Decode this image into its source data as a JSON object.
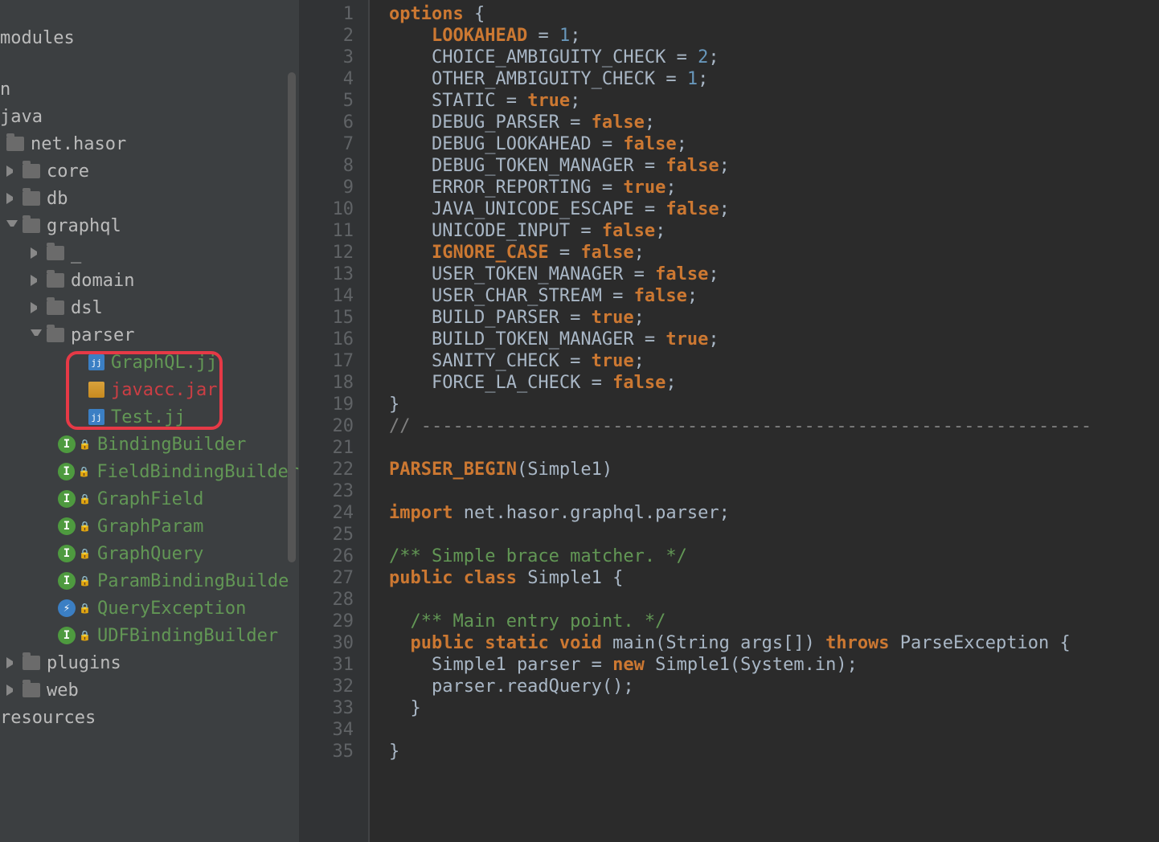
{
  "tree": {
    "modules": "modules",
    "n": "n",
    "java": "java",
    "net_hasor": "net.hasor",
    "core": "core",
    "db": "db",
    "graphql": "graphql",
    "underscore": "_",
    "domain": "domain",
    "dsl": "dsl",
    "parser": "parser",
    "graphql_jj": "GraphQL.jj",
    "javacc_jar": "javacc.jar",
    "test_jj": "Test.jj",
    "binding_builder": "BindingBuilder",
    "field_binding_builder": "FieldBindingBuilder",
    "graph_field": "GraphField",
    "graph_param": "GraphParam",
    "graph_query": "GraphQuery",
    "param_binding_builder": "ParamBindingBuilde",
    "query_exception": "QueryException",
    "udf_binding_builder": "UDFBindingBuilder",
    "plugins": "plugins",
    "web": "web",
    "resources": "resources"
  },
  "code": {
    "lines": [
      {
        "n": 1,
        "t": [
          {
            "c": "k-orange",
            "s": "options"
          },
          {
            "c": "plain",
            "s": " {"
          }
        ]
      },
      {
        "n": 2,
        "t": [
          {
            "c": "plain",
            "s": "    "
          },
          {
            "c": "k-orange",
            "s": "LOOKAHEAD"
          },
          {
            "c": "plain",
            "s": " = "
          },
          {
            "c": "num",
            "s": "1"
          },
          {
            "c": "plain",
            "s": ";"
          }
        ]
      },
      {
        "n": 3,
        "t": [
          {
            "c": "plain",
            "s": "    CHOICE_AMBIGUITY_CHECK = "
          },
          {
            "c": "num",
            "s": "2"
          },
          {
            "c": "plain",
            "s": ";"
          }
        ]
      },
      {
        "n": 4,
        "t": [
          {
            "c": "plain",
            "s": "    OTHER_AMBIGUITY_CHECK = "
          },
          {
            "c": "num",
            "s": "1"
          },
          {
            "c": "plain",
            "s": ";"
          }
        ]
      },
      {
        "n": 5,
        "t": [
          {
            "c": "plain",
            "s": "    STATIC = "
          },
          {
            "c": "k-orange",
            "s": "true"
          },
          {
            "c": "plain",
            "s": ";"
          }
        ]
      },
      {
        "n": 6,
        "t": [
          {
            "c": "plain",
            "s": "    DEBUG_PARSER = "
          },
          {
            "c": "k-orange",
            "s": "false"
          },
          {
            "c": "plain",
            "s": ";"
          }
        ]
      },
      {
        "n": 7,
        "t": [
          {
            "c": "plain",
            "s": "    DEBUG_LOOKAHEAD = "
          },
          {
            "c": "k-orange",
            "s": "false"
          },
          {
            "c": "plain",
            "s": ";"
          }
        ]
      },
      {
        "n": 8,
        "t": [
          {
            "c": "plain",
            "s": "    DEBUG_TOKEN_MANAGER = "
          },
          {
            "c": "k-orange",
            "s": "false"
          },
          {
            "c": "plain",
            "s": ";"
          }
        ]
      },
      {
        "n": 9,
        "t": [
          {
            "c": "plain",
            "s": "    ERROR_REPORTING = "
          },
          {
            "c": "k-orange",
            "s": "true"
          },
          {
            "c": "plain",
            "s": ";"
          }
        ]
      },
      {
        "n": 10,
        "t": [
          {
            "c": "plain",
            "s": "    JAVA_UNICODE_ESCAPE = "
          },
          {
            "c": "k-orange",
            "s": "false"
          },
          {
            "c": "plain",
            "s": ";"
          }
        ]
      },
      {
        "n": 11,
        "t": [
          {
            "c": "plain",
            "s": "    UNICODE_INPUT = "
          },
          {
            "c": "k-orange",
            "s": "false"
          },
          {
            "c": "plain",
            "s": ";"
          }
        ]
      },
      {
        "n": 12,
        "t": [
          {
            "c": "plain",
            "s": "    "
          },
          {
            "c": "k-orange",
            "s": "IGNORE_CASE"
          },
          {
            "c": "plain",
            "s": " = "
          },
          {
            "c": "k-orange",
            "s": "false"
          },
          {
            "c": "plain",
            "s": ";"
          }
        ]
      },
      {
        "n": 13,
        "t": [
          {
            "c": "plain",
            "s": "    USER_TOKEN_MANAGER = "
          },
          {
            "c": "k-orange",
            "s": "false"
          },
          {
            "c": "plain",
            "s": ";"
          }
        ]
      },
      {
        "n": 14,
        "t": [
          {
            "c": "plain",
            "s": "    USER_CHAR_STREAM = "
          },
          {
            "c": "k-orange",
            "s": "false"
          },
          {
            "c": "plain",
            "s": ";"
          }
        ]
      },
      {
        "n": 15,
        "t": [
          {
            "c": "plain",
            "s": "    BUILD_PARSER = "
          },
          {
            "c": "k-orange",
            "s": "true"
          },
          {
            "c": "plain",
            "s": ";"
          }
        ]
      },
      {
        "n": 16,
        "t": [
          {
            "c": "plain",
            "s": "    BUILD_TOKEN_MANAGER = "
          },
          {
            "c": "k-orange",
            "s": "true"
          },
          {
            "c": "plain",
            "s": ";"
          }
        ]
      },
      {
        "n": 17,
        "t": [
          {
            "c": "plain",
            "s": "    SANITY_CHECK = "
          },
          {
            "c": "k-orange",
            "s": "true"
          },
          {
            "c": "plain",
            "s": ";"
          }
        ]
      },
      {
        "n": 18,
        "t": [
          {
            "c": "plain",
            "s": "    FORCE_LA_CHECK = "
          },
          {
            "c": "k-orange",
            "s": "false"
          },
          {
            "c": "plain",
            "s": ";"
          }
        ]
      },
      {
        "n": 19,
        "t": [
          {
            "c": "plain",
            "s": "}"
          }
        ]
      },
      {
        "n": 20,
        "t": [
          {
            "c": "cmt",
            "s": "// ---------------------------------------------------------------"
          }
        ]
      },
      {
        "n": 21,
        "t": []
      },
      {
        "n": 22,
        "t": [
          {
            "c": "k-orange",
            "s": "PARSER_BEGIN"
          },
          {
            "c": "plain",
            "s": "(Simple1)"
          }
        ]
      },
      {
        "n": 23,
        "t": []
      },
      {
        "n": 24,
        "t": [
          {
            "c": "kw",
            "s": "import"
          },
          {
            "c": "plain",
            "s": " net.hasor.graphql.parser;"
          }
        ]
      },
      {
        "n": 25,
        "t": []
      },
      {
        "n": 26,
        "t": [
          {
            "c": "doc",
            "s": "/** Simple brace matcher. */"
          }
        ]
      },
      {
        "n": 27,
        "t": [
          {
            "c": "kw",
            "s": "public class"
          },
          {
            "c": "plain",
            "s": " Simple1 {"
          }
        ]
      },
      {
        "n": 28,
        "t": []
      },
      {
        "n": 29,
        "t": [
          {
            "c": "plain",
            "s": "  "
          },
          {
            "c": "doc",
            "s": "/** Main entry point. */"
          }
        ]
      },
      {
        "n": 30,
        "t": [
          {
            "c": "plain",
            "s": "  "
          },
          {
            "c": "kw",
            "s": "public static void"
          },
          {
            "c": "plain",
            "s": " main(String args[]) "
          },
          {
            "c": "kw",
            "s": "throws"
          },
          {
            "c": "plain",
            "s": " ParseException {"
          }
        ]
      },
      {
        "n": 31,
        "t": [
          {
            "c": "plain",
            "s": "    Simple1 parser = "
          },
          {
            "c": "kw",
            "s": "new"
          },
          {
            "c": "plain",
            "s": " Simple1(System.in);"
          }
        ]
      },
      {
        "n": 32,
        "t": [
          {
            "c": "plain",
            "s": "    parser.readQuery();"
          }
        ]
      },
      {
        "n": 33,
        "t": [
          {
            "c": "plain",
            "s": "  }"
          }
        ]
      },
      {
        "n": 34,
        "t": []
      },
      {
        "n": 35,
        "t": [
          {
            "c": "plain",
            "s": "}"
          }
        ]
      }
    ]
  }
}
